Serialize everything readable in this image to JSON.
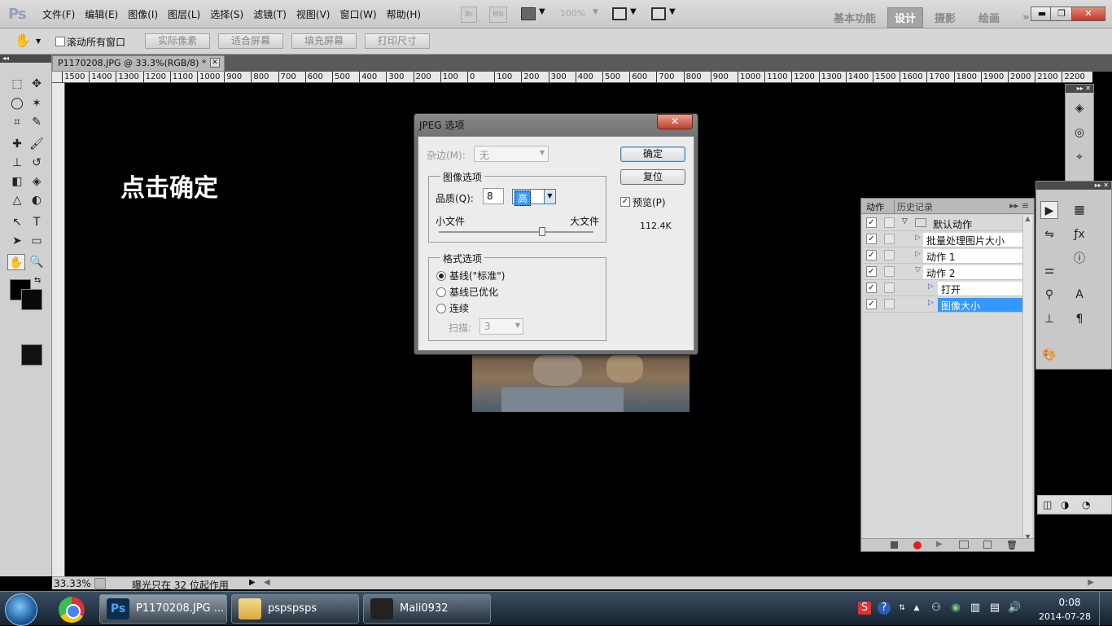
{
  "app": {
    "logo": "Ps"
  },
  "menu": [
    "文件(F)",
    "编辑(E)",
    "图像(I)",
    "图层(L)",
    "选择(S)",
    "滤镜(T)",
    "视图(V)",
    "窗口(W)",
    "帮助(H)"
  ],
  "appbar": {
    "br": "Br",
    "mb": "Mb",
    "zoom": "100%"
  },
  "workspaces": {
    "items": [
      "基本功能",
      "设计",
      "摄影",
      "绘画"
    ],
    "active": "设计",
    "more": "»"
  },
  "window_controls": {
    "minimize": "▬",
    "restore": "❐",
    "close": "✕"
  },
  "options": {
    "scroll_all": "滚动所有窗口",
    "actual_pixels": "实际像素",
    "fit_screen": "适合屏幕",
    "fill_screen": "填充屏幕",
    "print_size": "打印尺寸"
  },
  "document": {
    "tab_title": "P1170208.JPG @ 33.3%(RGB/8) *",
    "tab_close": "✕"
  },
  "ruler": {
    "h_ticks": [
      "1500",
      "1400",
      "1300",
      "1200",
      "1100",
      "1000",
      "900",
      "800",
      "700",
      "600",
      "500",
      "400",
      "300",
      "200",
      "100",
      "0",
      "100",
      "200",
      "300",
      "400",
      "500",
      "600",
      "700",
      "800",
      "900",
      "1000",
      "1100",
      "1200",
      "1300",
      "1400",
      "1500",
      "1600",
      "1700",
      "1800",
      "1900",
      "2000",
      "2100",
      "2200"
    ]
  },
  "instruction": "点击确定",
  "dialog": {
    "title": "JPEG 选项",
    "close": "✕",
    "matte_label": "杂边(M):",
    "matte_value": "无",
    "image_options": "图像选项",
    "quality_label": "品质(Q):",
    "quality_value": "8",
    "quality_preset": "高",
    "small_file": "小文件",
    "large_file": "大文件",
    "slider_level": 0.67,
    "format_options": "格式选项",
    "formats": [
      "基线(\"标准\")",
      "基线已优化",
      "连续"
    ],
    "format_selected": 0,
    "scans_label": "扫描:",
    "scans_value": "3",
    "ok": "确定",
    "reset": "复位",
    "preview_label": "预览(P)",
    "preview_checked": true,
    "file_size": "112.4K"
  },
  "actions_panel": {
    "tabs": [
      "动作",
      "历史记录"
    ],
    "rows": [
      {
        "label": "默认动作",
        "type": "set"
      },
      {
        "label": "批量处理图片大小",
        "type": "action"
      },
      {
        "label": "动作 1",
        "type": "action"
      },
      {
        "label": "动作 2",
        "type": "action-open"
      },
      {
        "label": "打开",
        "type": "step"
      },
      {
        "label": "图像大小",
        "type": "step",
        "selected": true
      }
    ]
  },
  "status": {
    "zoom": "33.33%",
    "message": "曝光只在 32 位起作用"
  },
  "taskbar": {
    "items": [
      "P1170208.JPG ...",
      "pspspsps",
      "Mali0932"
    ],
    "time": "0:08",
    "date": "2014-07-28"
  },
  "colors": {
    "accent_selected": "#3399ff",
    "canvas_bg": "#000000",
    "menubar_bg": "#d4d4d4",
    "taskbar_bg": "#1e2d3b"
  }
}
